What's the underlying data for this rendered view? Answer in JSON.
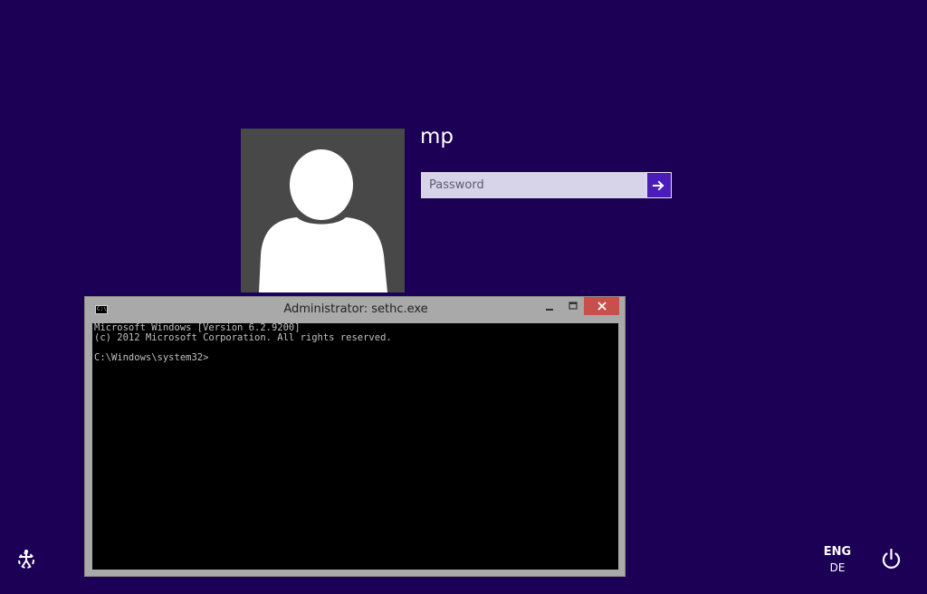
{
  "login": {
    "username": "mp",
    "password_placeholder": "Password",
    "submit_icon": "arrow-right-icon"
  },
  "avatar": {
    "icon": "user-silhouette-icon",
    "background": "#484848"
  },
  "console": {
    "title": "Administrator: sethc.exe",
    "icon": "cmd-icon",
    "lines": [
      "Microsoft Windows [Version 6.2.9200]",
      "(c) 2012 Microsoft Corporation. All rights reserved.",
      "",
      "C:\\Windows\\system32>"
    ]
  },
  "bottom_bar": {
    "ease_of_access_icon": "ease-of-access-icon",
    "language_main": "ENG",
    "language_sub": "DE",
    "power_icon": "power-icon"
  },
  "colors": {
    "background": "#1c0055",
    "accent": "#4a1cb8",
    "close_button": "#c7504a"
  }
}
